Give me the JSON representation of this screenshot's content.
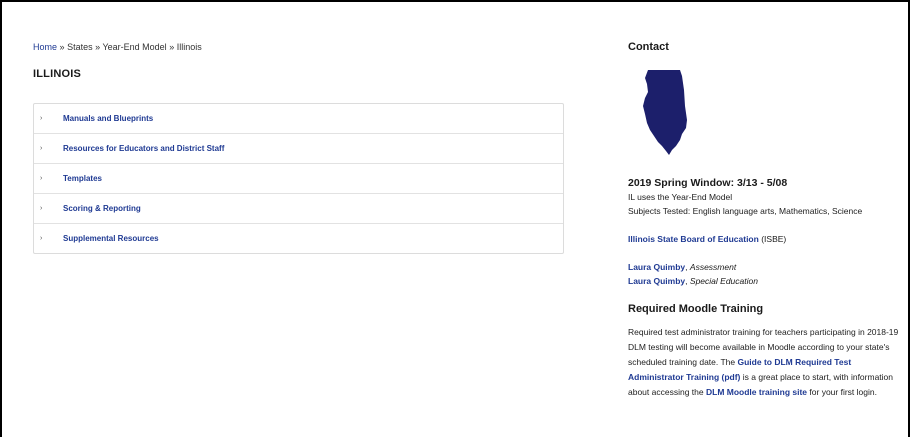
{
  "breadcrumb": {
    "home": "Home",
    "sep": "»",
    "states": "States",
    "model": "Year-End Model",
    "current": "Illinois"
  },
  "page": {
    "title": "ILLINOIS"
  },
  "accordion": [
    {
      "label": "Manuals and Blueprints"
    },
    {
      "label": "Resources for Educators and District Staff"
    },
    {
      "label": "Templates"
    },
    {
      "label": "Scoring & Reporting"
    },
    {
      "label": "Supplemental Resources"
    }
  ],
  "sidebar": {
    "contact_title": "Contact",
    "window_title": "2019 Spring Window: 3/13 - 5/08",
    "model_text": "IL uses the Year-End Model",
    "subjects_text": "Subjects Tested: English language arts, Mathematics, Science",
    "board_link": "Illinois State Board of Education",
    "board_abbr": "(ISBE)",
    "contacts": [
      {
        "name": "Laura Quimby",
        "sep": ",",
        "role": "Assessment"
      },
      {
        "name": "Laura Quimby",
        "sep": ",",
        "role": "Special Education"
      }
    ],
    "training_title": "Required Moodle Training",
    "training": {
      "p1": "Required test administrator training for teachers participating in 2018-19 DLM testing will become available in Moodle according to your state's scheduled training date. The",
      "link1": "Guide to DLM Required Test Administrator Training (pdf)",
      "p2": "is a great place to start, with information about accessing the",
      "link2": "DLM Moodle training site",
      "p3": "for your first login."
    }
  },
  "colors": {
    "link": "#1f3a93",
    "map": "#1c1f6b"
  }
}
